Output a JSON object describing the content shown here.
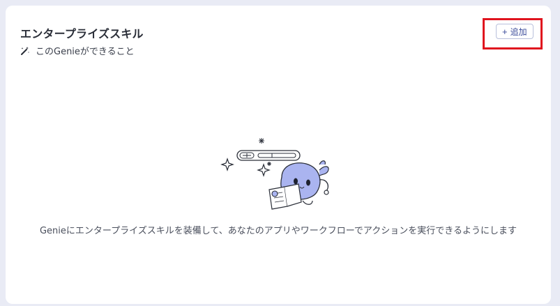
{
  "card": {
    "title": "エンタープライズスキル",
    "subtitle": "このGenieができること",
    "add_button_label": "追加",
    "empty_message": "Genieにエンタープライズスキルを装備して、あなたのアプリやワークフローでアクションを実行できるようにします"
  },
  "icons": {
    "subtitle_icon": "magic-wand-icon",
    "add_icon": "plus-icon",
    "illustration": "genie-mascot-illustration"
  },
  "colors": {
    "background": "#e9ebf5",
    "card": "#ffffff",
    "accent": "#3a4a9a",
    "highlight": "#e0141e",
    "mascot": "#aab4f0"
  }
}
